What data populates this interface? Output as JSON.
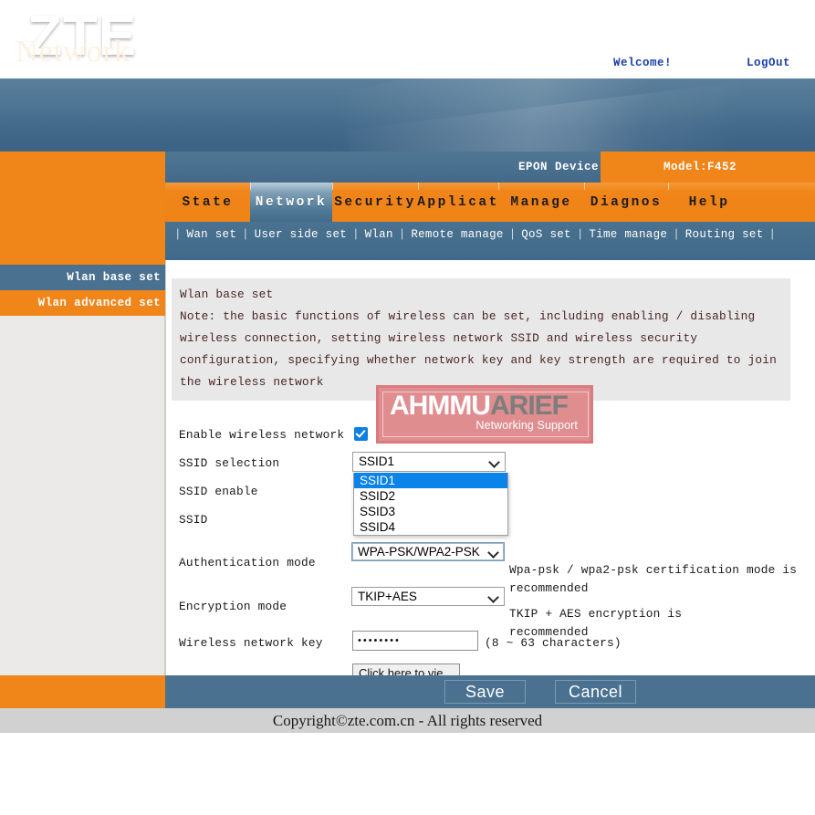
{
  "banner": {
    "logo": "ZTE",
    "welcome": "Welcome!",
    "logout": "LogOut"
  },
  "midbar": {
    "device": "EPON Device",
    "model": "Model:F452"
  },
  "section_title": "Network",
  "tabs": [
    {
      "label": "State",
      "active": false
    },
    {
      "label": "Network",
      "active": true
    },
    {
      "label": "Security",
      "active": false
    },
    {
      "label": "Applicat",
      "active": false
    },
    {
      "label": "Manage",
      "active": false
    },
    {
      "label": "Diagnos",
      "active": false
    },
    {
      "label": "Help",
      "active": false
    }
  ],
  "subnav": {
    "items": [
      "Wan set",
      "User side set",
      "Wlan",
      "Remote manage",
      "QoS set",
      "Time manage",
      "Routing set"
    ],
    "separator": "|"
  },
  "sidebar": {
    "items": [
      {
        "label": "Wlan base set",
        "selected": true
      },
      {
        "label": "Wlan advanced set",
        "selected": false
      }
    ]
  },
  "note": {
    "heading": "Wlan base set",
    "lines": [
      "Note: the basic functions of wireless can be set, including enabling / disabling",
      "wireless connection, setting wireless network SSID and wireless security",
      "configuration, specifying whether network key and key strength are required to join",
      "the wireless network"
    ]
  },
  "watermark": {
    "part1": "AHMMU",
    "part2": "ARIEF",
    "subtitle": "Networking Support"
  },
  "form": {
    "enable_wireless": {
      "label": "Enable wireless network",
      "checked": true
    },
    "ssid_selection": {
      "label": "SSID selection",
      "value": "SSID1",
      "options": [
        "SSID1",
        "SSID2",
        "SSID3",
        "SSID4"
      ],
      "open": true,
      "highlighted": "SSID1"
    },
    "ssid_enable": {
      "label": "SSID enable"
    },
    "ssid": {
      "label": "SSID"
    },
    "authentication_mode": {
      "label": "Authentication mode",
      "value": "WPA-PSK/WPA2-PSK",
      "hint": "Wpa-psk / wpa2-psk certification mode is recommended"
    },
    "encryption_mode": {
      "label": "Encryption mode",
      "value": "TKIP+AES",
      "hint": "TKIP + AES encryption is recommended"
    },
    "wireless_key": {
      "label": "Wireless network key",
      "value": "••••••••",
      "hint": "(8 ~ 63 characters)"
    },
    "view_key_button": "Click here to vie"
  },
  "actions": {
    "save": "Save",
    "cancel": "Cancel"
  },
  "footer": "Copyright©zte.com.cn - All rights reserved",
  "colors": {
    "orange": "#f08519",
    "steel_blue": "#4a7290",
    "banner_blue": "#4f7693",
    "link_blue": "#1b3ea8",
    "note_bg": "#e8e8e8",
    "note_text": "#4a2525",
    "watermark_pink": "#e08d90",
    "dropdown_highlight": "#0a84e8",
    "footer_bg": "#d1d1d1"
  }
}
